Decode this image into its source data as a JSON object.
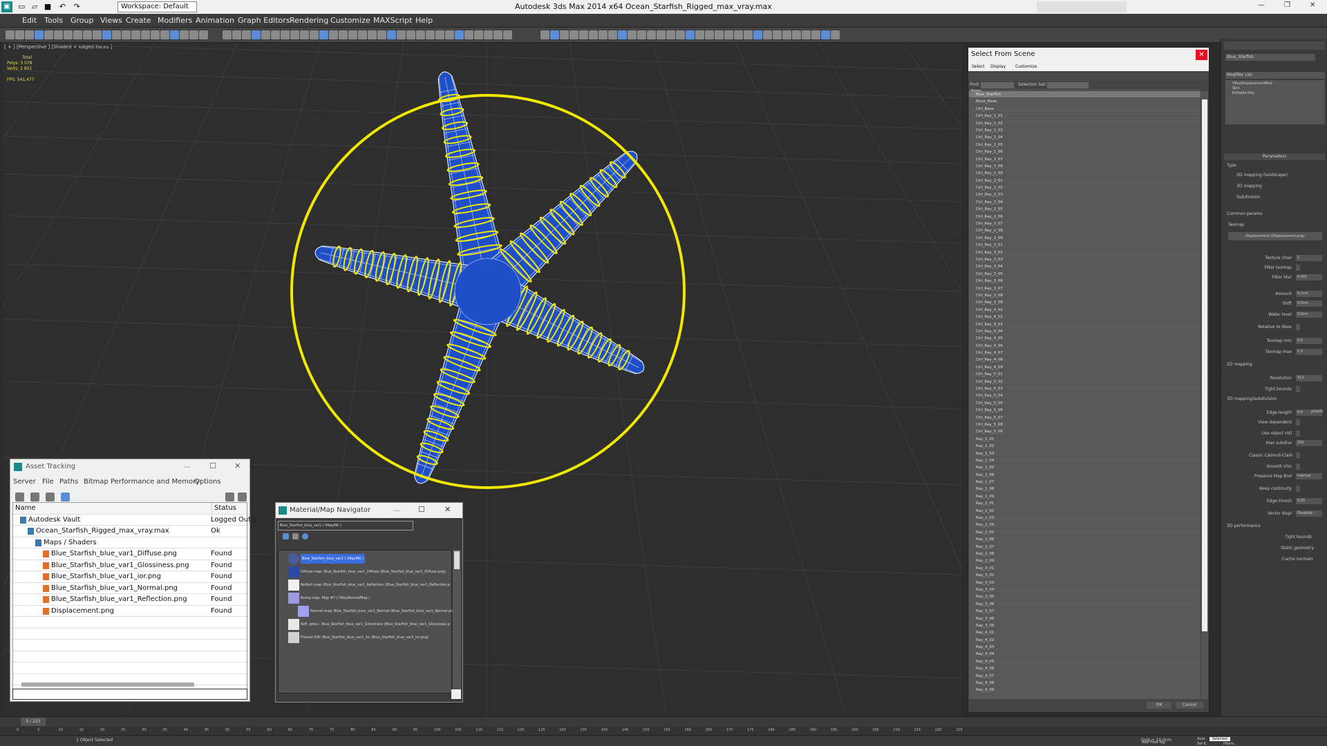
{
  "titlebar": {
    "workspace_label": "Workspace: Default",
    "app_title": "Autodesk 3ds Max  2014 x64     Ocean_Starfish_Rigged_max_vray.max"
  },
  "menu": [
    "Edit",
    "Tools",
    "Group",
    "Views",
    "Create",
    "Modifiers",
    "Animation",
    "Graph Editors",
    "Rendering",
    "Customize",
    "MAXScript",
    "Help"
  ],
  "viewport": {
    "label": "[ + ] [Perspective ] [Shaded + Edged Faces ]",
    "stats_total": "Total",
    "stats_polys": "Polys:  3 078",
    "stats_verts": "Verts:  2 851",
    "stats_fps": "FPS:     541,477"
  },
  "select_from_scene": {
    "title": "Select From Scene",
    "menu": [
      "Select",
      "Display",
      "Customize"
    ],
    "find_label": "Find:",
    "selection_set_label": "Selection Set:",
    "col_name": "Name",
    "items": [
      "Blue_Starfish",
      "Bone_Base",
      "Ctrl_Base",
      "Ctrl_Ray_1_01",
      "Ctrl_Ray_1_02",
      "Ctrl_Ray_1_03",
      "Ctrl_Ray_1_04",
      "Ctrl_Ray_1_05",
      "Ctrl_Ray_1_06",
      "Ctrl_Ray_1_07",
      "Ctrl_Ray_1_08",
      "Ctrl_Ray_1_09",
      "Ctrl_Ray_2_01",
      "Ctrl_Ray_2_02",
      "Ctrl_Ray_2_03",
      "Ctrl_Ray_2_04",
      "Ctrl_Ray_2_05",
      "Ctrl_Ray_2_06",
      "Ctrl_Ray_2_07",
      "Ctrl_Ray_2_08",
      "Ctrl_Ray_2_09",
      "Ctrl_Ray_3_01",
      "Ctrl_Ray_3_02",
      "Ctrl_Ray_3_03",
      "Ctrl_Ray_3_04",
      "Ctrl_Ray_3_05",
      "Ctrl_Ray_3_06",
      "Ctrl_Ray_3_07",
      "Ctrl_Ray_3_08",
      "Ctrl_Ray_3_09",
      "Ctrl_Ray_4_01",
      "Ctrl_Ray_4_02",
      "Ctrl_Ray_4_03",
      "Ctrl_Ray_4_04",
      "Ctrl_Ray_4_05",
      "Ctrl_Ray_4_06",
      "Ctrl_Ray_4_07",
      "Ctrl_Ray_4_08",
      "Ctrl_Ray_4_09",
      "Ctrl_Ray_5_01",
      "Ctrl_Ray_5_02",
      "Ctrl_Ray_5_03",
      "Ctrl_Ray_5_04",
      "Ctrl_Ray_5_05",
      "Ctrl_Ray_5_06",
      "Ctrl_Ray_5_07",
      "Ctrl_Ray_5_08",
      "Ctrl_Ray_5_09",
      "Ray_1_01",
      "Ray_1_02",
      "Ray_1_03",
      "Ray_1_04",
      "Ray_1_05",
      "Ray_1_06",
      "Ray_1_07",
      "Ray_1_08",
      "Ray_1_09",
      "Ray_2_01",
      "Ray_2_02",
      "Ray_2_03",
      "Ray_2_04",
      "Ray_2_05",
      "Ray_2_06",
      "Ray_2_07",
      "Ray_2_08",
      "Ray_2_09",
      "Ray_3_01",
      "Ray_3_02",
      "Ray_3_03",
      "Ray_3_04",
      "Ray_3_05",
      "Ray_3_06",
      "Ray_3_07",
      "Ray_3_08",
      "Ray_3_09",
      "Ray_4_01",
      "Ray_4_02",
      "Ray_4_03",
      "Ray_4_04",
      "Ray_4_05",
      "Ray_4_06",
      "Ray_4_07",
      "Ray_4_08",
      "Ray_4_09"
    ],
    "ok": "OK",
    "cancel": "Cancel"
  },
  "asset_tracking": {
    "title": "Asset Tracking",
    "menu": [
      "Server",
      "File",
      "Paths",
      "Bitmap Performance and Memory",
      "Options"
    ],
    "col_name": "Name",
    "col_status": "Status",
    "rows": [
      {
        "name": "Autodesk Vault",
        "status": "Logged Out (",
        "indent": 0
      },
      {
        "name": "Ocean_Starfish_Rigged_max_vray.max",
        "status": "Ok",
        "indent": 1
      },
      {
        "name": "Maps / Shaders",
        "status": "",
        "indent": 2
      },
      {
        "name": "Blue_Starfish_blue_var1_Diffuse.png",
        "status": "Found",
        "indent": 3
      },
      {
        "name": "Blue_Starfish_blue_var1_Glossiness.png",
        "status": "Found",
        "indent": 3
      },
      {
        "name": "Blue_Starfish_blue_var1_ior.png",
        "status": "Found",
        "indent": 3
      },
      {
        "name": "Blue_Starfish_blue_var1_Normal.png",
        "status": "Found",
        "indent": 3
      },
      {
        "name": "Blue_Starfish_blue_var1_Reflection.png",
        "status": "Found",
        "indent": 3
      },
      {
        "name": "Displacement.png",
        "status": "Found",
        "indent": 3
      }
    ]
  },
  "material_navigator": {
    "title": "Material/Map Navigator",
    "field": "Blue_Starfish_blue_var1  ( VRayMtl )",
    "nodes": [
      "Blue_Starfish_blue_var1  ( VRayMtl )",
      "Diffuse map: Blue_Starfish_blue_var1_Diffuse (Blue_Starfish_blue_var1_Diffuse.png)",
      "Reflect map: Blue_Starfish_blue_var1_Reflection (Blue_Starfish_blue_var1_Reflection.p",
      "Bump map: Map #7  ( VRayNormalMap )",
      "Normal map: Blue_Starfish_blue_var1_Normal (Blue_Starfish_blue_var1_Normal.png)",
      "Refl. gloss.: Blue_Starfish_blue_var1_Glossiness (Blue_Starfish_blue_var1_Glossiness.p",
      "Fresnel IOR: Blue_Starfish_blue_var1_ior (Blue_Starfish_blue_var1_ior.png)"
    ]
  },
  "modifier_panel": {
    "object_name": "Blue_Starfish",
    "modifier_list": "Modifier List",
    "stack": [
      "VRayDisplacementMod",
      "Skin",
      "Editable Poly"
    ],
    "params_title": "Parameters",
    "type_label": "Type",
    "types": [
      "2D mapping (landscape)",
      "3D mapping",
      "Subdivision"
    ],
    "common_params": "Common params",
    "texmap_label": "Texmap",
    "texmap_button": "Displacement (Displacement.png)",
    "fields": [
      {
        "label": "Texture chan",
        "value": "1"
      },
      {
        "label": "Filter texmap",
        "value": ""
      },
      {
        "label": "Filter blur",
        "value": "0,001"
      },
      {
        "label": "Amount",
        "value": "0,2cm"
      },
      {
        "label": "Shift",
        "value": "0,0cm"
      },
      {
        "label": "Water level",
        "value": "0,0cm"
      },
      {
        "label": "Relative to bbox",
        "value": ""
      },
      {
        "label": "Texmap min",
        "value": "0,0"
      },
      {
        "label": "Texmap max",
        "value": "1,0"
      },
      {
        "label": "Resolution",
        "value": "512"
      },
      {
        "label": "Tight bounds",
        "value": ""
      },
      {
        "label": "Edge length",
        "value": "4,0"
      },
      {
        "label": "View-dependent",
        "value": ""
      },
      {
        "label": "Use object mtl",
        "value": ""
      },
      {
        "label": "Max subdivs",
        "value": "256"
      },
      {
        "label": "Classic Catmull-Clark",
        "value": ""
      },
      {
        "label": "Smooth UVs",
        "value": ""
      },
      {
        "label": "Preserve Map Bnd",
        "value": "Internal"
      },
      {
        "label": "Keep continuity",
        "value": ""
      },
      {
        "label": "Edge thresh",
        "value": "0,05"
      },
      {
        "label": "Vector displ",
        "value": "Disabled"
      }
    ],
    "sections": [
      "2D mapping",
      "3D mapping/subdivision",
      "3D performance"
    ],
    "perf": [
      "Tight bounds",
      "Static geometry",
      "Cache normals"
    ],
    "pixels": "pixels"
  },
  "status": {
    "frame": "0 / 225",
    "selected": "1 Object Selected",
    "grid": "Grid = 10,0cm",
    "add_time_tag": "Add Time Tag",
    "auto": "Auto",
    "selected_dd": "Selected",
    "set_k": "Set K.",
    "filters": "Filters..."
  },
  "timeline_ticks": [
    "0",
    "5",
    "10",
    "15",
    "20",
    "25",
    "30",
    "35",
    "40",
    "45",
    "50",
    "55",
    "60",
    "65",
    "70",
    "75",
    "80",
    "85",
    "90",
    "95",
    "100",
    "105",
    "110",
    "115",
    "120",
    "125",
    "130",
    "135",
    "140",
    "145",
    "150",
    "155",
    "160",
    "165",
    "170",
    "175",
    "180",
    "185",
    "190",
    "195",
    "200",
    "205",
    "210",
    "215",
    "220",
    "225"
  ],
  "colors": {
    "mesh": "#1e4fc8",
    "wire": "#ffffff",
    "rig": "#f0e800",
    "accent": "#5b8dd6"
  }
}
